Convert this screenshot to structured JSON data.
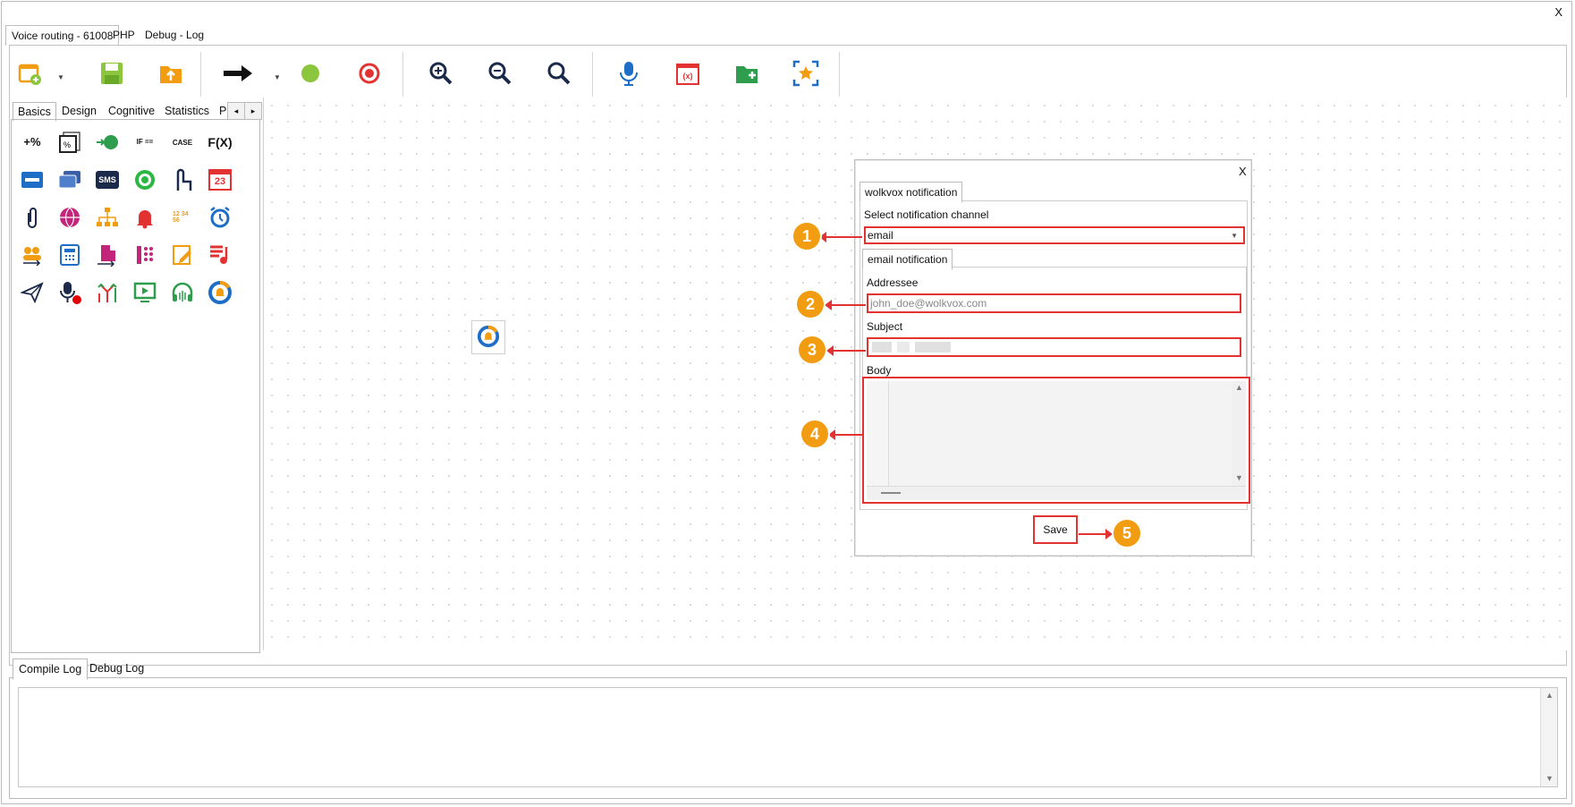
{
  "window": {
    "close_label": "X"
  },
  "main_tabs": [
    {
      "label": "Voice routing - 61008",
      "active": true
    },
    {
      "label": "PHP",
      "active": false
    },
    {
      "label": "Debug - Log",
      "active": false
    }
  ],
  "toolbar": {
    "buttons": [
      {
        "icon": "new-flow-icon"
      },
      {
        "icon": "save-icon"
      },
      {
        "icon": "upload-icon"
      },
      {
        "icon": "connector-arrow-icon"
      },
      {
        "icon": "start-icon"
      },
      {
        "icon": "stop-icon"
      },
      {
        "icon": "zoom-in-icon"
      },
      {
        "icon": "zoom-out-icon"
      },
      {
        "icon": "zoom-fit-icon"
      },
      {
        "icon": "microphone-icon"
      },
      {
        "icon": "variables-icon"
      },
      {
        "icon": "add-folder-icon"
      },
      {
        "icon": "select-area-icon"
      }
    ],
    "variables_glyph": "(x)"
  },
  "palette": {
    "tabs": [
      {
        "label": "Basics",
        "active": true
      },
      {
        "label": "Design",
        "active": false
      },
      {
        "label": "Cognitive",
        "active": false
      },
      {
        "label": "Statistics",
        "active": false
      },
      {
        "label": "P",
        "active": false
      }
    ],
    "glyphs": {
      "calc": "+%",
      "if_then_else": "IF ==",
      "case": "CASE",
      "function": "F(X)",
      "sms": "SMS",
      "calendar_day": "23",
      "numbers": "12 34 56"
    },
    "icons": [
      [
        "calculator-icon",
        "percent-table-icon",
        "global-variable-icon",
        "if-then-else-icon",
        "case-icon",
        "function-icon"
      ],
      [
        "card-reader-icon",
        "cards-icon",
        "sms-icon",
        "whatsapp-icon",
        "touch-input-icon",
        "calendar-icon"
      ],
      [
        "attachment-icon",
        "web-globe-icon",
        "hierarchy-icon",
        "alarm-bell-icon",
        "say-numbers-icon",
        "alarm-clock-icon"
      ],
      [
        "queue-transfer-icon",
        "ivr-phone-icon",
        "building-transfer-icon",
        "dial-phone-icon",
        "note-edit-icon",
        "music-playlist-icon"
      ],
      [
        "send-paper-plane-icon",
        "record-voice-icon",
        "split-route-icon",
        "play-video-icon",
        "audio-headset-icon",
        "notification-icon"
      ]
    ],
    "nav_prev": "◂",
    "nav_next": "▸"
  },
  "dialog": {
    "close_label": "X",
    "tab_label": "wolkvox notification",
    "channel_label": "Select notification channel",
    "channel_value": "email",
    "email_tab_label": "email notification",
    "addressee_label": "Addressee",
    "addressee_value": "john_doe@wolkvox.com",
    "subject_label": "Subject",
    "subject_value": "",
    "body_label": "Body",
    "body_value": "",
    "save_label": "Save"
  },
  "callouts": [
    "1",
    "2",
    "3",
    "4",
    "5"
  ],
  "log": {
    "tabs": [
      {
        "label": "Compile Log",
        "active": true
      },
      {
        "label": "Debug Log",
        "active": false
      }
    ],
    "content": ""
  },
  "colors": {
    "highlight": "#e23232",
    "callout": "#f29c12",
    "green": "#8cc63f",
    "blue": "#1e6ec8"
  }
}
